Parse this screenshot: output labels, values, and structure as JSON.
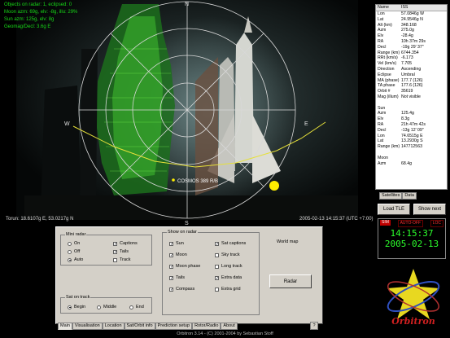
{
  "radar": {
    "overlay_lines": [
      "Objects on radar: 1, eclipsed: 0",
      "Moon azm: 69g, elv: -8g, illu: 29%",
      "Sun azm: 125g, elv: 8g",
      "Geomag/Decl: 3.6g E"
    ],
    "compass": {
      "n": "N",
      "s": "S",
      "e": "E",
      "w": "W"
    },
    "satellite_label": "COSMOS 389 R/B",
    "location": "Torun: 18.6107g E, 53.0217g N",
    "datetime": "2005-02-13 14:15:37 (UTC +7:00)"
  },
  "info": {
    "header": {
      "key": "Name",
      "value": "ISS"
    },
    "rows": [
      {
        "k": "Lon",
        "v": "57.0846g W"
      },
      {
        "k": "Lat",
        "v": "24.9546g N"
      },
      {
        "k": "Alt (km)",
        "v": "348.168"
      },
      {
        "k": "Azm",
        "v": "275.0g"
      },
      {
        "k": "Elv",
        "v": "-28.4g"
      },
      {
        "k": "RA",
        "v": "10h 37m 29s"
      },
      {
        "k": "Decl",
        "v": "-19g 29' 37\""
      },
      {
        "k": "Range (km)",
        "v": "6744.354"
      },
      {
        "k": "RRt (km/s)",
        "v": "-6.173"
      },
      {
        "k": "Vel (km/s)",
        "v": "7.705"
      },
      {
        "k": "Direction",
        "v": "Ascending"
      },
      {
        "k": "Eclipse",
        "v": "Umbral"
      },
      {
        "k": "MA (phase)",
        "v": "177.7 (126)"
      },
      {
        "k": "TA phase",
        "v": "177.6 (126)"
      },
      {
        "k": "Orbit #",
        "v": "35619"
      },
      {
        "k": "Mag (illum)",
        "v": "Not visible"
      },
      {
        "k": "",
        "v": ""
      },
      {
        "k": "Sun",
        "v": ""
      },
      {
        "k": "Azm",
        "v": "125.4g"
      },
      {
        "k": "Elv",
        "v": "8.3g"
      },
      {
        "k": "RA",
        "v": "21h 47m 42s"
      },
      {
        "k": "Decl",
        "v": "-13g 12' 09\""
      },
      {
        "k": "Lon",
        "v": "74.6515g E"
      },
      {
        "k": "Lat",
        "v": "13.2930g S"
      },
      {
        "k": "Range (km)",
        "v": "147712563"
      },
      {
        "k": "",
        "v": ""
      },
      {
        "k": "Moon",
        "v": ""
      },
      {
        "k": "Azm",
        "v": "68.4g"
      }
    ],
    "tabs": [
      "Satellites",
      "Data"
    ]
  },
  "buttons": {
    "load_tle": "Load TLE",
    "show_next": "Show next",
    "radar": "Radar"
  },
  "clock": {
    "sim": "SIM",
    "auto": "AUTO-OFF",
    "loc": "LOC",
    "time": "14:15:37",
    "date": "2005-02-13"
  },
  "settings": {
    "mini_radar": {
      "title": "Mini radar",
      "radios": [
        {
          "label": "On",
          "on": false
        },
        {
          "label": "Off",
          "on": false
        },
        {
          "label": "Auto",
          "on": true
        }
      ],
      "checks": [
        {
          "label": "Captions",
          "on": true
        },
        {
          "label": "Tails",
          "on": true
        },
        {
          "label": "Track",
          "on": false
        }
      ]
    },
    "sat_on_track": {
      "title": "Sat on track",
      "radios": [
        {
          "label": "Begin",
          "on": true
        },
        {
          "label": "Middle",
          "on": false
        },
        {
          "label": "End",
          "on": false
        }
      ]
    },
    "show_on_radar": {
      "title": "Show on radar",
      "left": [
        {
          "label": "Sun",
          "on": true
        },
        {
          "label": "Moon",
          "on": true
        },
        {
          "label": "Moon phase",
          "on": true
        },
        {
          "label": "Tails",
          "on": true
        },
        {
          "label": "Compass",
          "on": true
        }
      ],
      "right": [
        {
          "label": "Sat captions",
          "on": true
        },
        {
          "label": "Sky track",
          "on": false
        },
        {
          "label": "Long track",
          "on": false
        },
        {
          "label": "Extra data",
          "on": true
        },
        {
          "label": "Extra grid",
          "on": false
        }
      ]
    },
    "world_map_label": "World map"
  },
  "bottom_tabs": [
    "Main",
    "Visualisation",
    "Location",
    "Sat/Orbit info",
    "Prediction setup",
    "Rotor/Radio",
    "About"
  ],
  "help": "?",
  "status": "Orbitron 3.14 - (C) 2001-2004 by Sebastian Stoff",
  "logo_text": "Orbitron",
  "colors": {
    "grid": "#d8d8d8",
    "track": "#e6e03a",
    "sun": "#ffee00",
    "text_green": "#18d818",
    "clock_green": "#2cff2c",
    "sim_red": "#c00000"
  }
}
